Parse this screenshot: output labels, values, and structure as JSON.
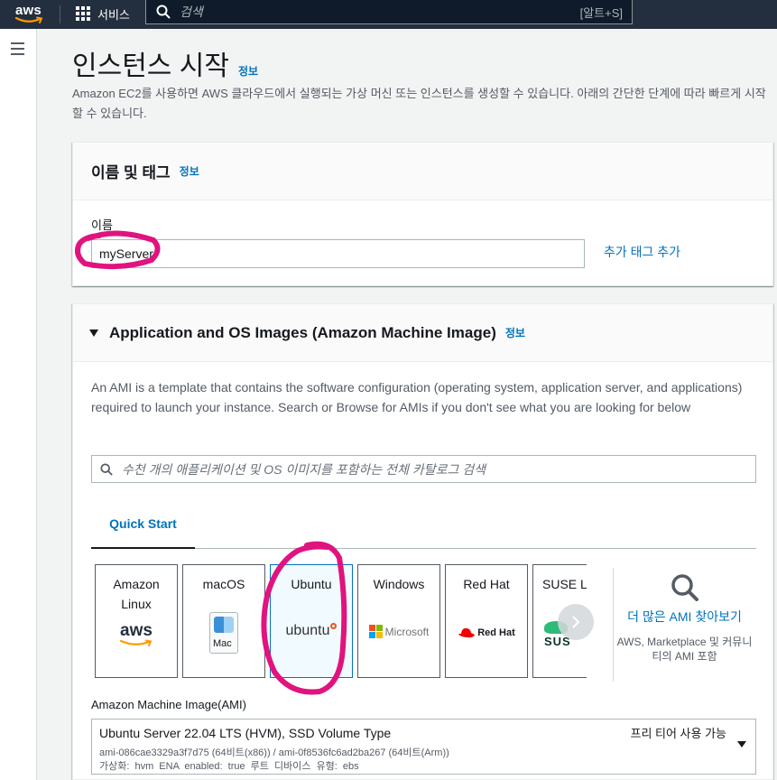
{
  "topnav": {
    "logo_text": "aws",
    "services_label": "서비스",
    "search_placeholder": "검색",
    "search_shortcut": "[알트+S]"
  },
  "page": {
    "title": "인스턴스 시작",
    "info": "정보",
    "description": "Amazon EC2를 사용하면 AWS 클라우드에서 실행되는 가상 머신 또는 인스턴스를 생성할 수 있습니다. 아래의 간단한 단계에 따라 빠르게 시작할 수 있습니다."
  },
  "name_tags": {
    "heading": "이름 및 태그",
    "info": "정보",
    "name_label": "이름",
    "name_value": "myServer",
    "add_tag_label": "추가 태그 추가"
  },
  "ami": {
    "heading": "Application and OS Images (Amazon Machine Image)",
    "info": "정보",
    "description": "An AMI is a template that contains the software configuration (operating system, application server, and applications) required to launch your instance. Search or Browse for AMIs if you don't see what you are looking for below",
    "search_placeholder": "수천 개의 애플리케이션 및 OS 이미지를 포함하는 전체 카탈로그 검색",
    "tab_quick_start": "Quick Start",
    "os_tiles": [
      {
        "name": "Amazon Linux",
        "logo": "aws"
      },
      {
        "name": "macOS",
        "logo": "Mac"
      },
      {
        "name": "Ubuntu",
        "logo": "ubuntu"
      },
      {
        "name": "Windows",
        "logo": "Microsoft"
      },
      {
        "name": "Red Hat",
        "logo": "Red Hat"
      },
      {
        "name": "SUSE Li",
        "logo": "SUS"
      }
    ],
    "browse_more_link": "더 많은 AMI 찾아보기",
    "browse_more_sub": "AWS, Marketplace 및 커뮤니티의 AMI 포함",
    "ami_label": "Amazon Machine Image(AMI)",
    "selected_ami": {
      "title": "Ubuntu Server 22.04 LTS (HVM), SSD Volume Type",
      "ids": "ami-086cae3329a3f7d75 (64비트(x86)) / ami-0f8536fc6ad2ba267 (64비트(Arm))",
      "meta": "가상화: hvm    ENA enabled: true    루트 디바이스 유형: ebs",
      "tier": "프리 티어 사용 가능"
    }
  },
  "colors": {
    "nav_bg": "#232f3e",
    "link": "#0073bb",
    "highlight_marker": "#e0137f",
    "aws_orange": "#ff9900"
  }
}
